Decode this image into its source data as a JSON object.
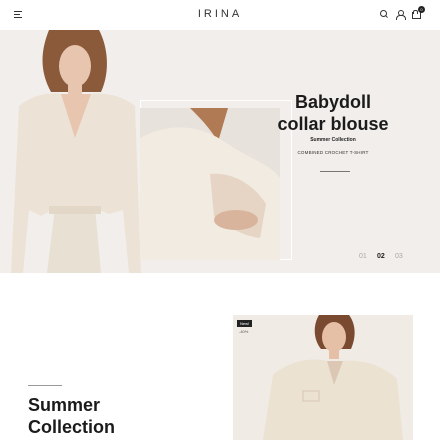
{
  "header": {
    "logo": "IRINA",
    "cart_count": "0"
  },
  "hero": {
    "title_line1": "Babydoll",
    "title_line2": "collar blouse",
    "subtitle": "Summer Collection",
    "caption": "COMBINED CROCHET T-SHIRT",
    "pager": [
      "01",
      "02",
      "03"
    ],
    "active_slide": "02"
  },
  "collection": {
    "title_line1": "Summer",
    "title_line2": "Collection",
    "product": {
      "badge": "New!",
      "discount": "-40%"
    }
  },
  "colors": {
    "hero_bg": "#f1eeeb",
    "text": "#1b1b1b",
    "accent": "#222222"
  }
}
